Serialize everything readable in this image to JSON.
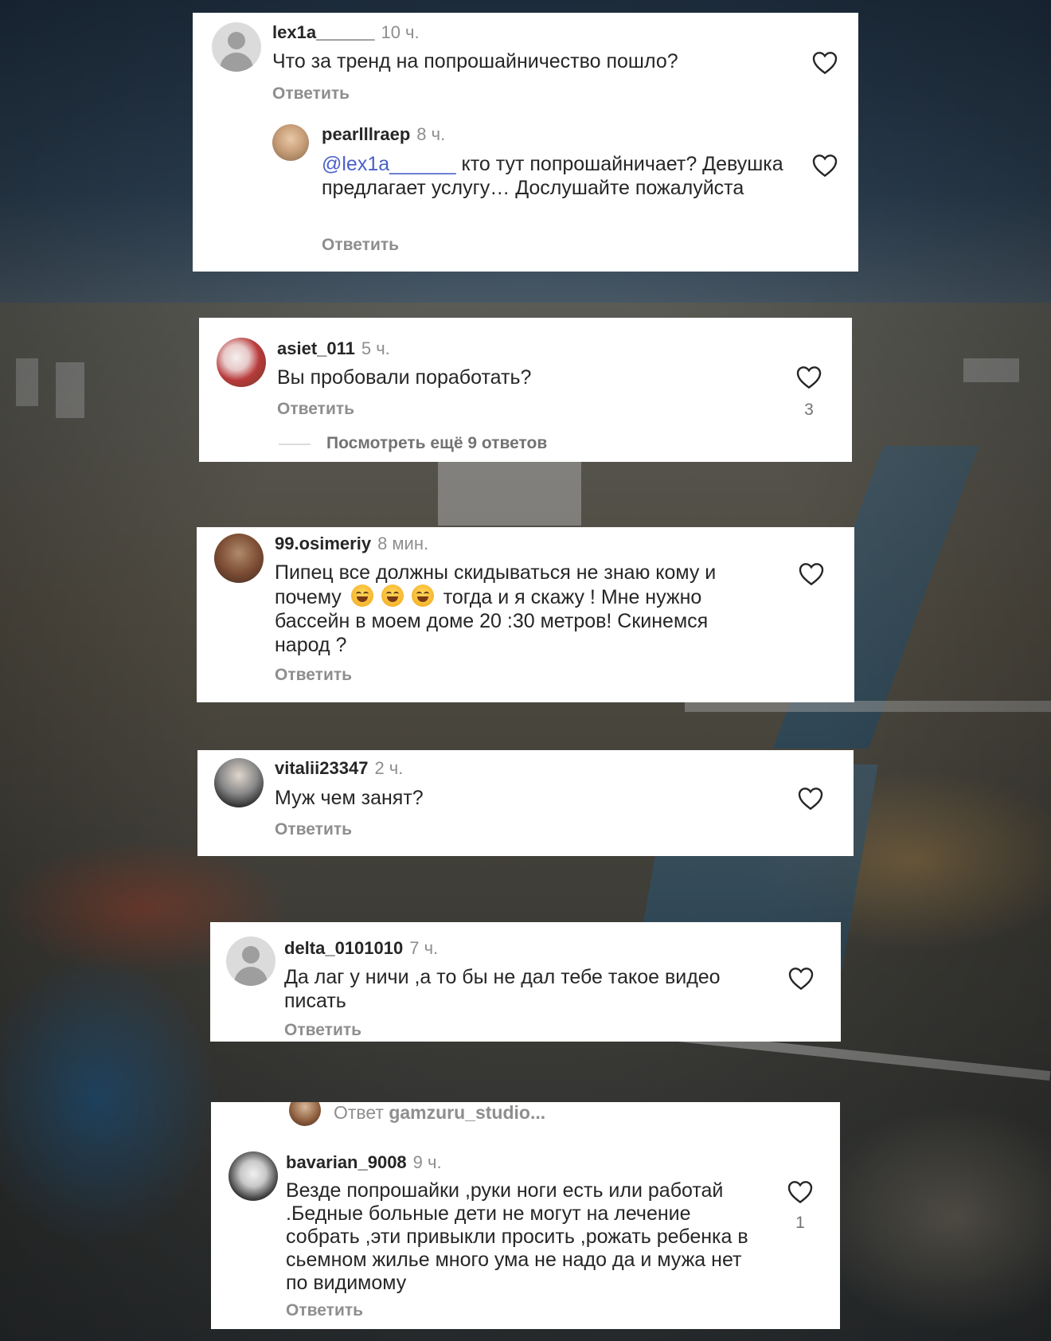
{
  "comments": [
    {
      "username": "lex1a______",
      "time": "10 ч.",
      "text": "Что за тренд на попрошайничество пошло?",
      "reply_label": "Ответить",
      "avatar": "default",
      "reply": {
        "username": "pearlllraep",
        "time": "8 ч.",
        "mention": "@lex1a______",
        "text": " кто тут попрошайничает? Девушка  предлагает услугу… Дослушайте пожалуйста",
        "reply_label": "Ответить"
      }
    },
    {
      "username": "asiet_011",
      "time": "5 ч.",
      "text": "Вы пробовали поработать?",
      "reply_label": "Ответить",
      "likes": "3",
      "view_more": "Посмотреть ещё 9 ответов"
    },
    {
      "username": "99.osimeriy",
      "time": "8 мин.",
      "text_part1": "Пипец все должны скидываться не знаю кому и почему",
      "emoji": "😂😂😂",
      "text_part2": " тогда и я скажу ! Мне нужно бассейн в моем доме 20 :30 метров! Скинемся народ ?",
      "reply_label": "Ответить"
    },
    {
      "username": "vitalii23347",
      "time": "2 ч.",
      "text": "Муж чем занят?",
      "reply_label": "Ответить"
    },
    {
      "username": "delta_0101010",
      "time": "7 ч.",
      "text": "Да лаг у ничи ,а то бы не дал тебе такое видео писать",
      "reply_label": "Ответить",
      "avatar": "default"
    },
    {
      "reply_to_prefix": "Ответ",
      "reply_to_user": "gamzuru_studio...",
      "username": "bavarian_9008",
      "time": "9 ч.",
      "text": "Везде попрошайки ,руки ноги есть или работай .Бедные  больные дети не могут на лечение собрать ,эти привыкли просить ,рожать ребенка в сьемном жилье много ума не надо да и мужа нет по видимому",
      "reply_label": "Ответить",
      "likes": "1"
    }
  ],
  "icons": {
    "like": "heart-icon",
    "default_avatar": "default-avatar-icon"
  },
  "colors": {
    "mention": "#4a60c9",
    "secondary_text": "#8e8e8e",
    "primary_text": "#262626"
  }
}
